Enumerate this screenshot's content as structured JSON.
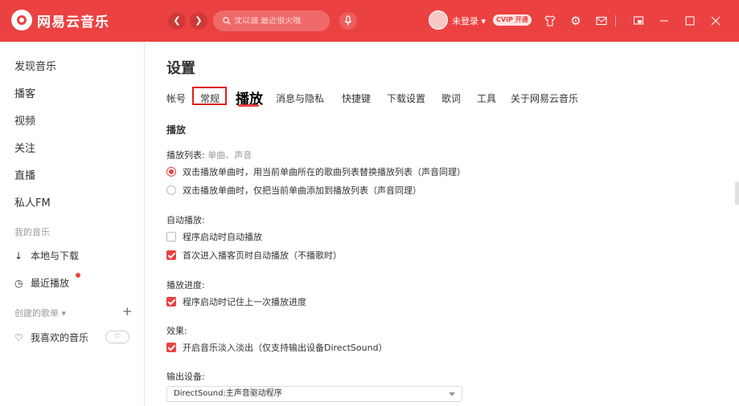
{
  "app": {
    "title": "网易云音乐"
  },
  "colors": {
    "brand": "#ec4141",
    "text": "#333333",
    "muted": "#9b9b9b"
  },
  "titlebar": {
    "back_icon": "chevron-left-icon",
    "forward_icon": "chevron-right-icon",
    "search_placeholder": "沈以诚 最近很火哦",
    "user_label": "未登录 ▾",
    "vip_label": "CVIP 开通"
  },
  "sidebar": {
    "items": [
      "发现音乐",
      "播客",
      "视频",
      "关注",
      "直播",
      "私人FM"
    ],
    "my_music_title": "我的音乐",
    "my_music": [
      {
        "icon": "download-icon",
        "label": "本地与下载"
      },
      {
        "icon": "clock-icon",
        "label": "最近播放"
      }
    ],
    "created_title": "创建的歌单 ▾",
    "liked": {
      "icon": "heart-icon",
      "label": "我喜欢的音乐"
    }
  },
  "main": {
    "page_title": "设置",
    "tabs": [
      "帐号",
      "常规",
      "播放",
      "消息与隐私",
      "快捷键",
      "下载设置",
      "歌词",
      "工具",
      "关于网易云音乐"
    ],
    "active_tab": "播放",
    "section_title": "播放",
    "playlist_label": "播放列表:",
    "playlist_hint": "单曲、声音",
    "playlist_options": [
      {
        "label": "双击播放单曲时，用当前单曲所在的歌曲列表替换播放列表（声音同理）",
        "selected": true
      },
      {
        "label": "双击播放单曲时，仅把当前单曲添加到播放列表（声音同理）",
        "selected": false
      }
    ],
    "autoplay_label": "自动播放:",
    "autoplay_options": [
      {
        "label": "程序启动时自动播放",
        "checked": false
      },
      {
        "label": "首次进入播客页时自动播放（不播歌时）",
        "checked": true
      }
    ],
    "progress_label": "播放进度:",
    "progress_options": [
      {
        "label": "程序启动时记住上一次播放进度",
        "checked": true
      }
    ],
    "effect_label": "效果:",
    "effect_options": [
      {
        "label": "开启音乐淡入淡出（仅支持输出设备DirectSound）",
        "checked": true
      }
    ],
    "output_label": "输出设备:",
    "output_value": "DirectSound:主声音驱动程序"
  }
}
